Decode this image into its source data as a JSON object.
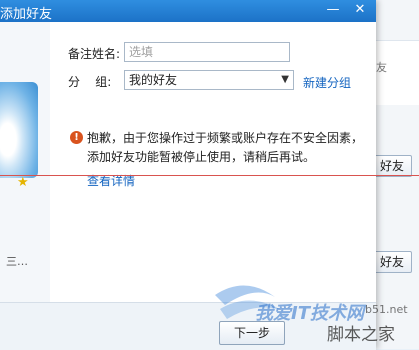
{
  "dialog": {
    "title": "添加好友",
    "minimize_glyph": "—",
    "close_glyph": "✕"
  },
  "left": {
    "name_text": "三…"
  },
  "form": {
    "remark_label": "备注姓名:",
    "remark_placeholder": "选填",
    "group_label": "分    组:",
    "group_value": "我的好友",
    "new_group_link": "新建分组"
  },
  "warning": {
    "icon_glyph": "!",
    "message": "抱歉，由于您操作过于频繁或账户存在不安全因素，添加好友功能暂被停止使用，请稍后再试。",
    "details_link": "查看详情"
  },
  "footer": {
    "next_button": "下一步"
  },
  "background_window": {
    "card_text": "友",
    "buttons": [
      "好友",
      "好友"
    ]
  },
  "watermark": {
    "text": "我爱IT技术网",
    "site": "b51.net",
    "brand": "脚本之家"
  },
  "colors": {
    "titlebar": "#1c72c7",
    "link": "#1565c0",
    "warning_icon": "#d9531e",
    "divider": "#d9534f",
    "star": "#e5b400"
  },
  "icons": {
    "warning": "warning-icon",
    "star": "star-icon",
    "dropdown": "chevron-down-icon"
  }
}
